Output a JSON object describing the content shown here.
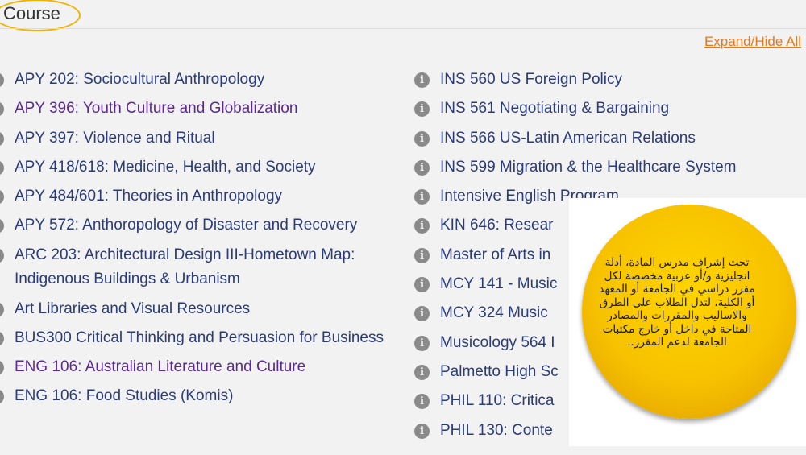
{
  "header": {
    "title": "Course",
    "expand_label": "Expand/Hide All"
  },
  "icons": {
    "info": "info-circle-icon",
    "info_glyph": "i"
  },
  "colors": {
    "link": "#2a3b78",
    "visited": "#5c2a8e",
    "accent": "#e8771e",
    "highlight": "#f0b400"
  },
  "left_items": [
    {
      "label": "APY 202: Sociocultural Anthropology",
      "visited": false
    },
    {
      "label": "APY 396: Youth Culture and Globalization",
      "visited": true
    },
    {
      "label": "APY 397: Violence and Ritual",
      "visited": false
    },
    {
      "label": "APY 418/618: Medicine, Health, and Society",
      "visited": false
    },
    {
      "label": "APY 484/601: Theories in Anthropology",
      "visited": false
    },
    {
      "label": "APY 572: Anthoropology of Disaster and Recovery",
      "visited": false
    },
    {
      "label": "ARC 203: Architectural Design III-Hometown Map: Indigenous Buildings & Urbanism",
      "visited": false
    },
    {
      "label": "Art Libraries and Visual Resources",
      "visited": false
    },
    {
      "label": "BUS300 Critical Thinking and Persuasion for Business",
      "visited": false
    },
    {
      "label": "ENG 106: Australian Literature and Culture",
      "visited": true
    },
    {
      "label": "ENG 106: Food Studies (Komis)",
      "visited": false
    }
  ],
  "right_items": [
    {
      "label": "INS 560 US Foreign Policy"
    },
    {
      "label": "INS 561 Negotiating & Bargaining"
    },
    {
      "label": "INS 566 US-Latin American Relations"
    },
    {
      "label": "INS 599 Migration & the Healthcare System"
    },
    {
      "label": "Intensive English Program"
    },
    {
      "label": "KIN 646: Resear"
    },
    {
      "label": "Master of Arts in"
    },
    {
      "label": "MCY 141 - Music"
    },
    {
      "label": "MCY 324 Music"
    },
    {
      "label": "Musicology 564 I"
    },
    {
      "label": "Palmetto High Sc"
    },
    {
      "label": "PHIL 110: Critica"
    },
    {
      "label": "PHIL 130: Conte"
    }
  ],
  "callout": {
    "text": "تحت إشراف مدرس المادة، أدلة انجليزية و/أو عربية مخصصة لكل مقرر دراسي في الجامعة أو المعهد أو الكلية، لتدل الطلاب على الطرق والاساليب والمقررات والمصادر المتاحة في داخل أو خارج مكتبات الجامعة لدعم المقرر.."
  }
}
